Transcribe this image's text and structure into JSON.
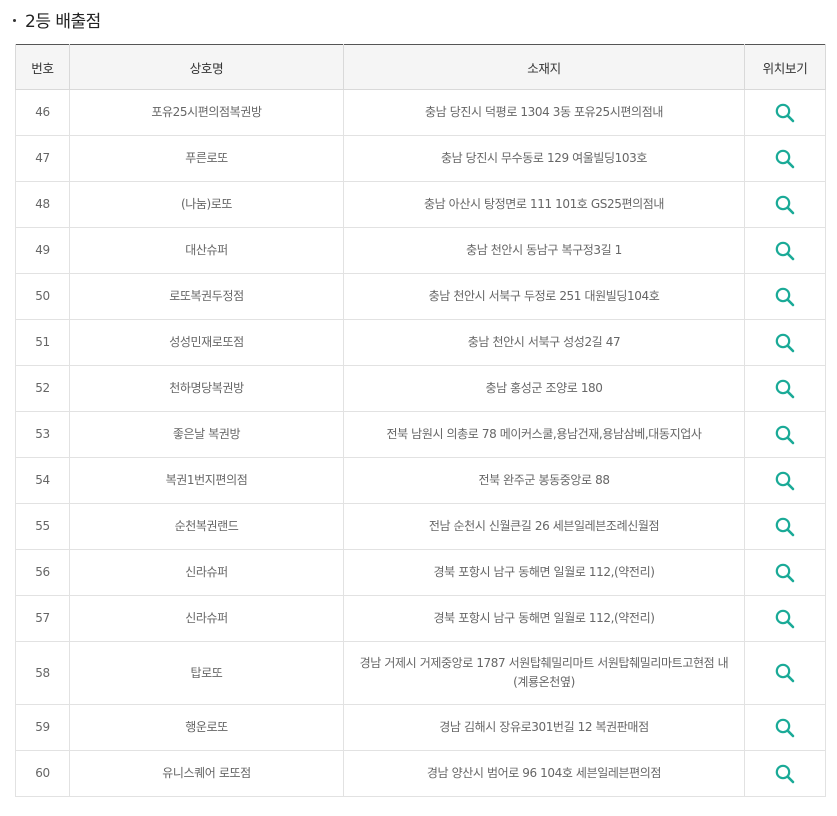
{
  "section": {
    "title": "2등 배출점"
  },
  "table": {
    "headers": {
      "no": "번호",
      "name": "상호명",
      "address": "소재지",
      "location": "위치보기"
    },
    "rows": [
      {
        "no": "46",
        "name": "포유25시편의점복권방",
        "address": "충남 당진시 덕평로 1304 3동 포유25시편의점내"
      },
      {
        "no": "47",
        "name": "푸른로또",
        "address": "충남 당진시 무수동로 129 여울빌딩103호"
      },
      {
        "no": "48",
        "name": "(나눔)로또",
        "address": "충남 아산시 탕정면로 111 101호 GS25편의점내"
      },
      {
        "no": "49",
        "name": "대산슈퍼",
        "address": "충남 천안시 동남구 복구정3길 1"
      },
      {
        "no": "50",
        "name": "로또복권두정점",
        "address": "충남 천안시 서북구 두정로 251 대원빌딩104호"
      },
      {
        "no": "51",
        "name": "성성민재로또점",
        "address": "충남 천안시 서북구 성성2길 47"
      },
      {
        "no": "52",
        "name": "천하명당복권방",
        "address": "충남 홍성군 조양로 180"
      },
      {
        "no": "53",
        "name": "좋은날 복권방",
        "address": "전북 남원시 의총로 78 메이커스쿨,용남건재,용남삼베,대동지업사"
      },
      {
        "no": "54",
        "name": "복권1번지편의점",
        "address": "전북 완주군 봉동중앙로 88"
      },
      {
        "no": "55",
        "name": "순천복권랜드",
        "address": "전남 순천시 신월큰길 26 세븐일레븐조례신월점"
      },
      {
        "no": "56",
        "name": "신라슈퍼",
        "address": "경북 포항시 남구 동해면 일월로 112,(약전리)"
      },
      {
        "no": "57",
        "name": "신라슈퍼",
        "address": "경북 포항시 남구 동해면 일월로 112,(약전리)"
      },
      {
        "no": "58",
        "name": "탑로또",
        "address": "경남 거제시 거제중앙로 1787 서원탑췌밀리마트 서원탑췌밀리마트고현점 내 (계룡온천옆)"
      },
      {
        "no": "59",
        "name": "행운로또",
        "address": "경남 김해시 장유로301번길 12 복권판매점"
      },
      {
        "no": "60",
        "name": "유니스퀘어 로또점",
        "address": "경남 양산시 범어로 96 104호 세븐일레븐편의점"
      }
    ]
  },
  "icons": {
    "location": "search-icon"
  },
  "colors": {
    "accent": "#1aaa97",
    "header_bg": "#f5f5f5",
    "top_border": "#555555"
  }
}
